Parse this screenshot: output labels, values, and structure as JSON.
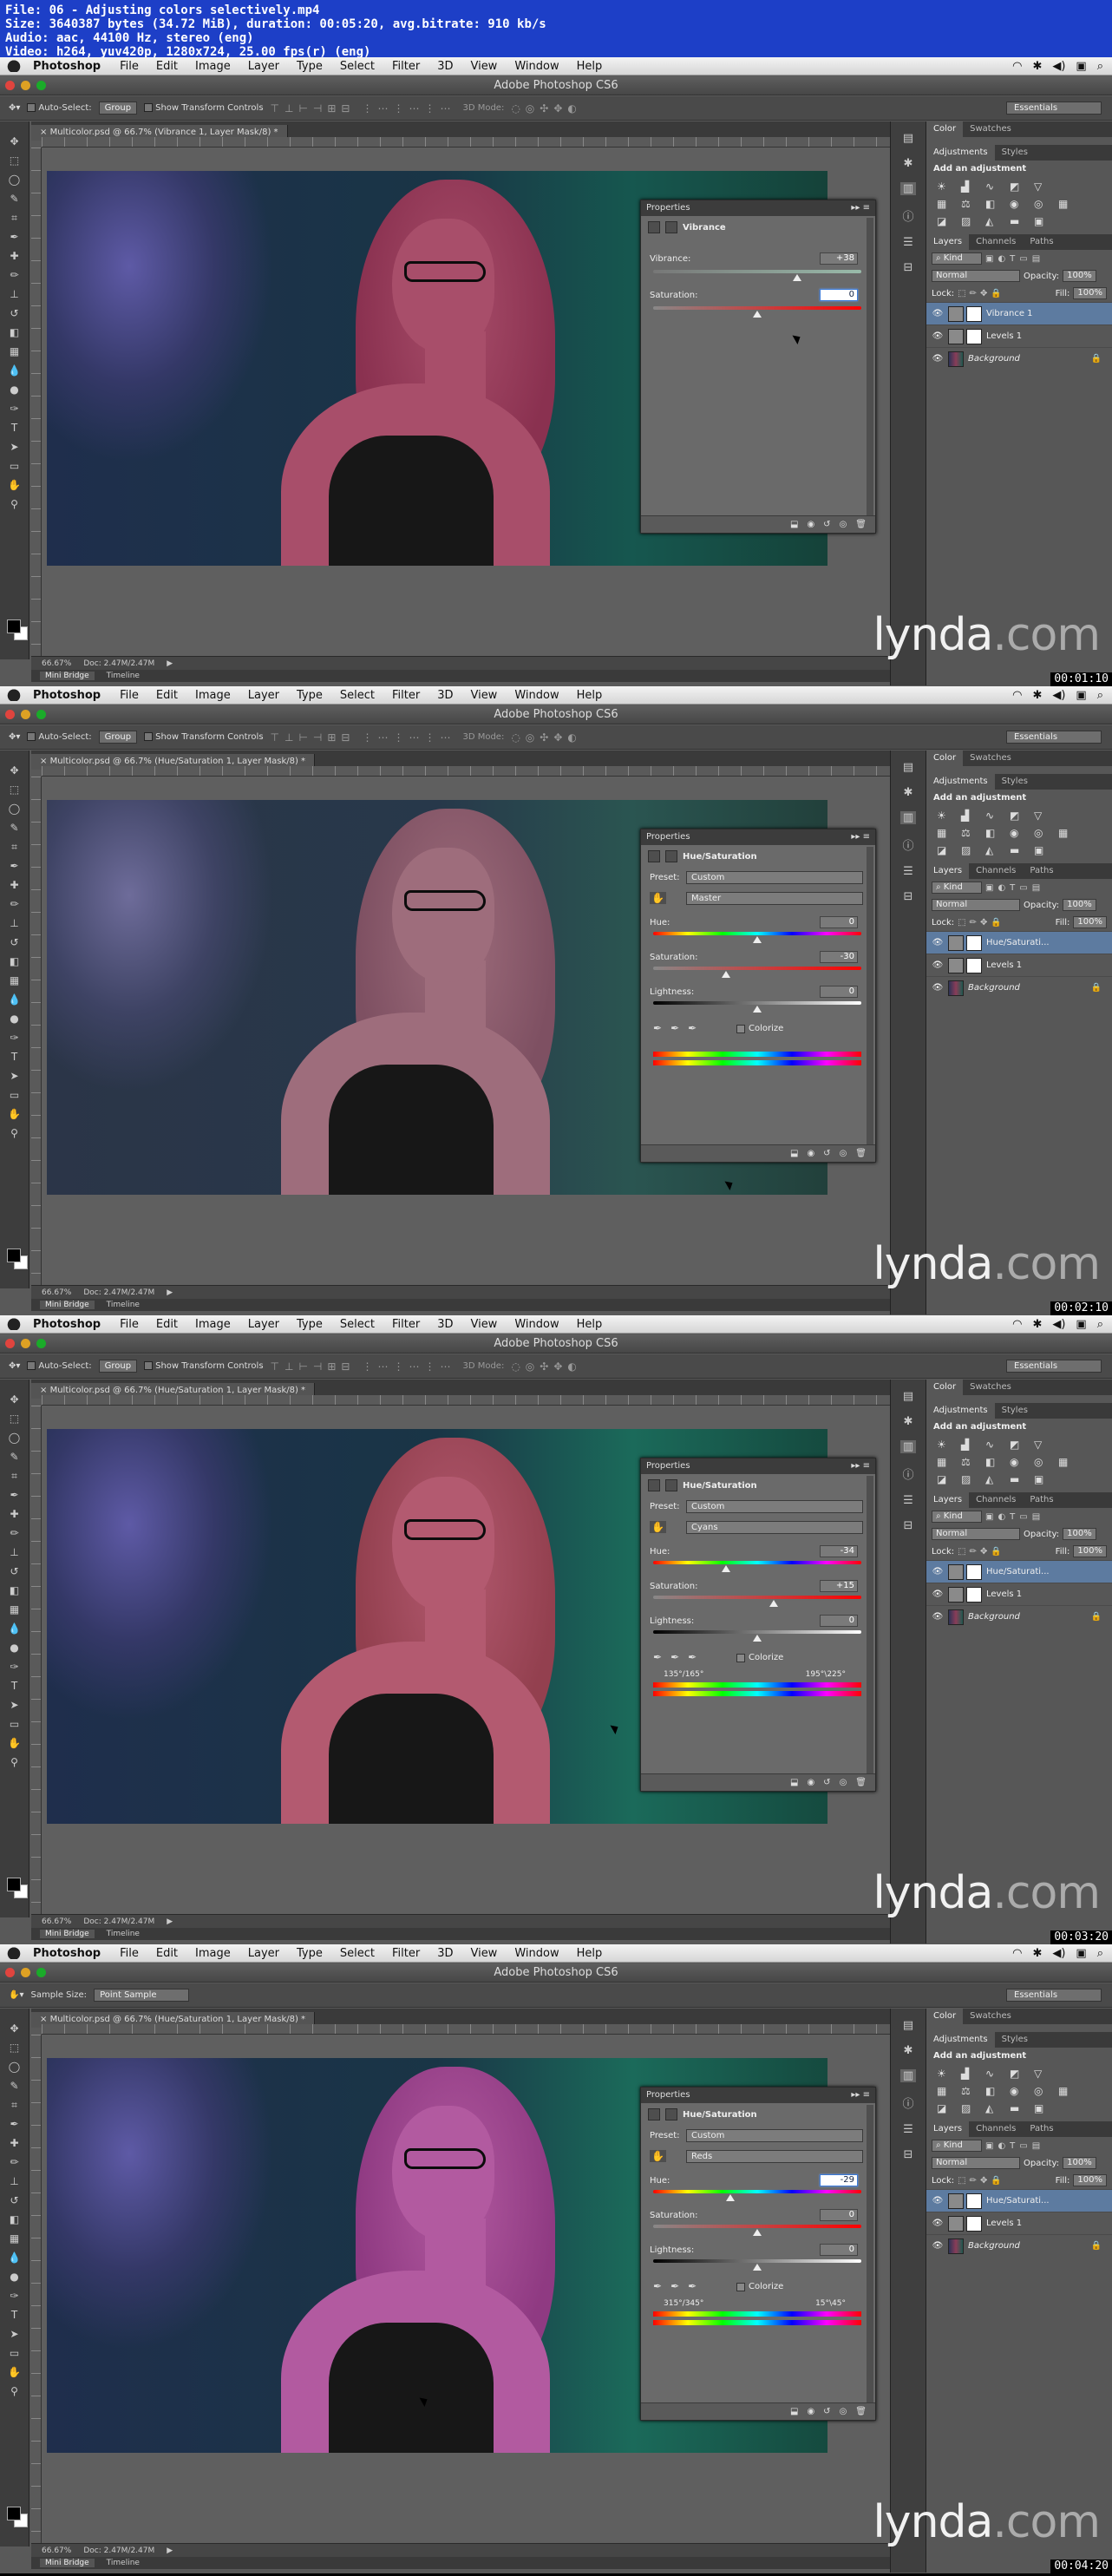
{
  "file_info": {
    "lines": [
      "File: 06 - Adjusting colors selectively.mp4",
      "Size: 3640387 bytes (34.72 MiB), duration: 00:05:20, avg.bitrate: 910 kb/s",
      "Audio: aac, 44100 Hz, stereo (eng)",
      "Video: h264, yuv420p, 1280x724, 25.00 fps(r) (eng)"
    ]
  },
  "menubar": {
    "app": "Photoshop",
    "items": [
      "File",
      "Edit",
      "Image",
      "Layer",
      "Type",
      "Select",
      "Filter",
      "3D",
      "View",
      "Window",
      "Help"
    ]
  },
  "window": {
    "title": "Adobe Photoshop CS6"
  },
  "options_move": {
    "auto_select": "Auto-Select:",
    "group": "Group",
    "show_transform": "Show Transform Controls",
    "mode_3d": "3D Mode:",
    "workspace": "Essentials"
  },
  "options_eyedropper": {
    "sample_size": "Sample Size:",
    "point_sample": "Point Sample",
    "workspace": "Essentials"
  },
  "status": {
    "zoom": "66.67%",
    "doc": "Doc: 2.47M/2.47M"
  },
  "minibridge": {
    "mini_bridge": "Mini Bridge",
    "timeline": "Timeline"
  },
  "right_panel": {
    "tab_color": "Color",
    "tab_swatches": "Swatches",
    "tab_adjustments": "Adjustments",
    "tab_styles": "Styles",
    "add_adjustment": "Add an adjustment",
    "tab_layers": "Layers",
    "tab_channels": "Channels",
    "tab_paths": "Paths",
    "kind": "Kind",
    "blend": "Normal",
    "opacity_label": "Opacity:",
    "opacity": "100%",
    "lock_label": "Lock:",
    "fill_label": "Fill:",
    "fill": "100%"
  },
  "watermark": {
    "brand": "lynda",
    "tld": ".com"
  },
  "frames": [
    {
      "timecode": "00:01:10",
      "tab": "Multicolor.psd @ 66.7% (Vibrance 1, Layer Mask/8) *",
      "layers": [
        "Vibrance 1",
        "Levels 1",
        "Background"
      ],
      "properties": {
        "header": "Properties",
        "adj_name": "Vibrance",
        "vibrance_label": "Vibrance:",
        "vibrance": "+38",
        "vibrance_frac": 0.69,
        "saturation_label": "Saturation:",
        "saturation": "0",
        "saturation_frac": 0.5
      }
    },
    {
      "timecode": "00:02:10",
      "tab": "Multicolor.psd @ 66.7% (Hue/Saturation 1, Layer Mask/8) *",
      "layers": [
        "Hue/Saturati...",
        "Levels 1",
        "Background"
      ],
      "properties": {
        "header": "Properties",
        "adj_name": "Hue/Saturation",
        "preset_label": "Preset:",
        "preset": "Custom",
        "channel": "Master",
        "hue_label": "Hue:",
        "hue": "0",
        "hue_frac": 0.5,
        "sat_label": "Saturation:",
        "sat": "-30",
        "sat_frac": 0.35,
        "light_label": "Lightness:",
        "light": "0",
        "light_frac": 0.5,
        "colorize": "Colorize"
      }
    },
    {
      "timecode": "00:03:20",
      "tab": "Multicolor.psd @ 66.7% (Hue/Saturation 1, Layer Mask/8) *",
      "layers": [
        "Hue/Saturati...",
        "Levels 1",
        "Background"
      ],
      "properties": {
        "header": "Properties",
        "adj_name": "Hue/Saturation",
        "preset_label": "Preset:",
        "preset": "Custom",
        "channel": "Cyans",
        "hue_label": "Hue:",
        "hue": "-34",
        "hue_frac": 0.35,
        "sat_label": "Saturation:",
        "sat": "+15",
        "sat_frac": 0.58,
        "light_label": "Lightness:",
        "light": "0",
        "light_frac": 0.5,
        "colorize": "Colorize",
        "range_left": "135°/165°",
        "range_right": "195°\\225°"
      }
    },
    {
      "timecode": "00:04:20",
      "tab": "Multicolor.psd @ 66.7% (Hue/Saturation 1, Layer Mask/8) *",
      "layers": [
        "Hue/Saturati...",
        "Levels 1",
        "Background"
      ],
      "properties": {
        "header": "Properties",
        "adj_name": "Hue/Saturation",
        "preset_label": "Preset:",
        "preset": "Custom",
        "channel": "Reds",
        "hue_label": "Hue:",
        "hue": "-29",
        "hue_frac": 0.37,
        "sat_label": "Saturation:",
        "sat": "0",
        "sat_frac": 0.5,
        "light_label": "Lightness:",
        "light": "0",
        "light_frac": 0.5,
        "colorize": "Colorize",
        "range_left": "315°/345°",
        "range_right": "15°\\45°"
      }
    }
  ]
}
